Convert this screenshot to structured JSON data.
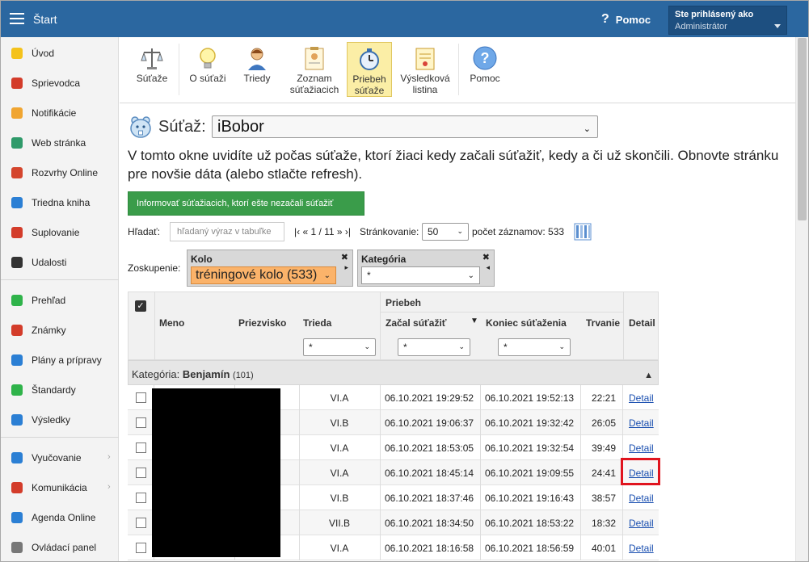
{
  "header": {
    "title": "Štart",
    "help_label": "Pomoc",
    "user_label": "Ste prihlásený ako",
    "user_role": "Administrátor"
  },
  "sidebar": {
    "items": [
      {
        "label": "Úvod",
        "icon": "star-icon",
        "color": "#f4c21b"
      },
      {
        "label": "Sprievodca",
        "icon": "wand-icon",
        "color": "#d33c2a"
      },
      {
        "label": "Notifikácie",
        "icon": "envelope-icon",
        "color": "#f0a531"
      },
      {
        "label": "Web stránka",
        "icon": "home-icon",
        "color": "#2f9a6a"
      },
      {
        "label": "Rozvrhy Online",
        "icon": "timetable-icon",
        "color": "#d4452d"
      },
      {
        "label": "Triedna kniha",
        "icon": "book-icon",
        "color": "#2b7fd4"
      },
      {
        "label": "Suplovanie",
        "icon": "person-icon",
        "color": "#d33c2a"
      },
      {
        "label": "Udalosti",
        "icon": "calendar-icon",
        "color": "#333333"
      },
      {
        "label": "Prehľad",
        "icon": "check-circle-icon",
        "color": "#2fb34a"
      },
      {
        "label": "Známky",
        "icon": "grade-icon",
        "color": "#d33c2a"
      },
      {
        "label": "Plány a prípravy",
        "icon": "briefcase-icon",
        "color": "#2b7fd4"
      },
      {
        "label": "Štandardy",
        "icon": "shield-icon",
        "color": "#2fb34a"
      },
      {
        "label": "Výsledky",
        "icon": "bar-chart-icon",
        "color": "#2b7fd4"
      },
      {
        "label": "Vyučovanie",
        "icon": "open-book-icon",
        "color": "#2b7fd4"
      },
      {
        "label": "Komunikácia",
        "icon": "chat-icon",
        "color": "#d33c2a"
      },
      {
        "label": "Agenda Online",
        "icon": "pen-icon",
        "color": "#2b7fd4"
      },
      {
        "label": "Ovládací panel",
        "icon": "gear-icon",
        "color": "#777777"
      }
    ]
  },
  "toolbar": {
    "items": [
      {
        "label": "Súťaže",
        "icon": "scales-icon"
      },
      {
        "label": "O súťaži",
        "icon": "lightbulb-icon"
      },
      {
        "label": "Triedy",
        "icon": "student-icon"
      },
      {
        "label": "Zoznam súťažiacich",
        "icon": "clipboard-icon"
      },
      {
        "label": "Priebeh súťaže",
        "icon": "stopwatch-icon"
      },
      {
        "label": "Výsledková listina",
        "icon": "certificate-icon"
      },
      {
        "label": "Pomoc",
        "icon": "question-icon"
      }
    ]
  },
  "competition": {
    "label": "Súťaž:",
    "selected": "iBobor",
    "description": "V tomto okne uvidíte už počas súťaže, ktorí žiaci kedy začali súťažiť, kedy a či už skončili. Obnovte stránku pre novšie dáta (alebo stlačte refresh).",
    "notify_button": "Informovať súťažiacich, ktorí ešte nezačali súťažiť"
  },
  "search": {
    "label": "Hľadať:",
    "placeholder": "hľadaný výraz v tabuľke",
    "pager": "|‹ « 1 / 11 » ›|",
    "paging_label": "Stránkovanie:",
    "paging_value": "50",
    "record_count": "počet záznamov: 533"
  },
  "grouping": {
    "label": "Zoskupenie:",
    "group1_title": "Kolo",
    "group1_value": "tréningové kolo (533)",
    "group2_title": "Kategória",
    "group2_value": "*"
  },
  "table": {
    "group_header": "Priebeh",
    "columns": [
      "Meno",
      "Priezvisko",
      "Trieda",
      "Začal súťažiť",
      "Koniec súťaženia",
      "Trvanie",
      "Detail"
    ],
    "filter_value": "*",
    "category_label": "Kategória:",
    "category_name": "Benjamín",
    "category_count": "(101)",
    "rows": [
      {
        "class": "VI.A",
        "start": "06.10.2021 19:29:52",
        "end": "06.10.2021 19:52:13",
        "duration": "22:21",
        "detail": "Detail"
      },
      {
        "class": "VI.B",
        "start": "06.10.2021 19:06:37",
        "end": "06.10.2021 19:32:42",
        "duration": "26:05",
        "detail": "Detail"
      },
      {
        "class": "VI.A",
        "start": "06.10.2021 18:53:05",
        "end": "06.10.2021 19:32:54",
        "duration": "39:49",
        "detail": "Detail"
      },
      {
        "class": "VI.A",
        "start": "06.10.2021 18:45:14",
        "end": "06.10.2021 19:09:55",
        "duration": "24:41",
        "detail": "Detail"
      },
      {
        "class": "VI.B",
        "start": "06.10.2021 18:37:46",
        "end": "06.10.2021 19:16:43",
        "duration": "38:57",
        "detail": "Detail"
      },
      {
        "class": "VII.B",
        "start": "06.10.2021 18:34:50",
        "end": "06.10.2021 18:53:22",
        "duration": "18:32",
        "detail": "Detail"
      },
      {
        "class": "VI.A",
        "start": "06.10.2021 18:16:58",
        "end": "06.10.2021 18:56:59",
        "duration": "40:01",
        "detail": "Detail"
      }
    ]
  }
}
